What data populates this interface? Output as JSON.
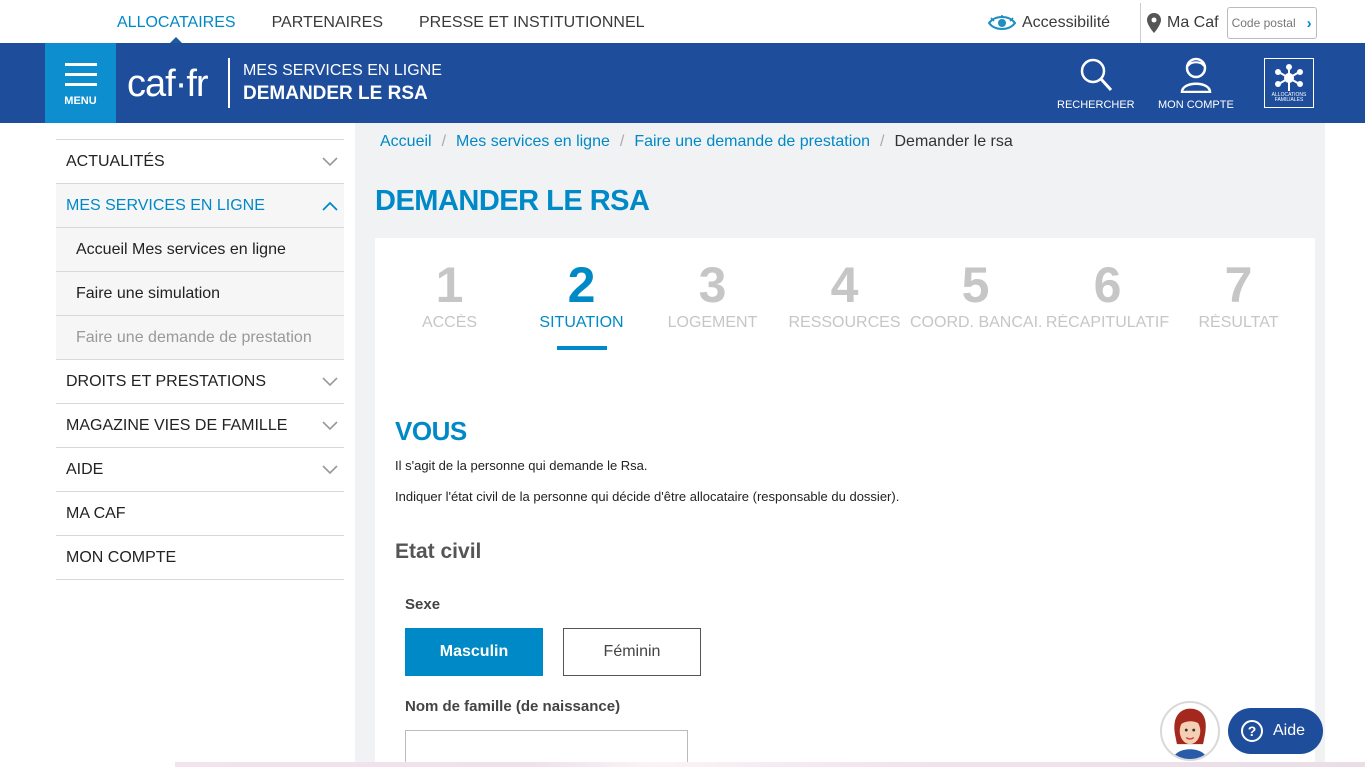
{
  "topbar": {
    "nav": [
      {
        "label": "ALLOCATAIRES",
        "active": true
      },
      {
        "label": "PARTENAIRES",
        "active": false
      },
      {
        "label": "PRESSE ET INSTITUTIONNEL",
        "active": false
      }
    ],
    "accessibility": "Accessibilité",
    "ma_caf": "Ma Caf",
    "postal_placeholder": "Code postal"
  },
  "header": {
    "menu_label": "MENU",
    "logo": "caf·fr",
    "title_line1": "MES SERVICES EN LIGNE",
    "title_line2": "DEMANDER LE RSA",
    "search_label": "RECHERCHER",
    "account_label": "MON COMPTE",
    "brand_small": "ALLOCATIONS FAMILIALES"
  },
  "sidebar": {
    "items": [
      {
        "label": "ACTUALITÉS"
      },
      {
        "label": "MES SERVICES EN LIGNE"
      },
      {
        "label": "Accueil Mes services en ligne"
      },
      {
        "label": "Faire une simulation"
      },
      {
        "label": "Faire une demande de prestation"
      },
      {
        "label": "DROITS ET PRESTATIONS"
      },
      {
        "label": "MAGAZINE VIES DE FAMILLE"
      },
      {
        "label": "AIDE"
      },
      {
        "label": "MA CAF"
      },
      {
        "label": "MON COMPTE"
      }
    ]
  },
  "breadcrumb": {
    "items": [
      "Accueil",
      "Mes services en ligne",
      "Faire une demande de prestation"
    ],
    "current": "Demander le rsa"
  },
  "page_title": "DEMANDER LE RSA",
  "steps": [
    {
      "num": "1",
      "label": "ACCÈS"
    },
    {
      "num": "2",
      "label": "SITUATION"
    },
    {
      "num": "3",
      "label": "LOGEMENT"
    },
    {
      "num": "4",
      "label": "RESSOURCES"
    },
    {
      "num": "5",
      "label": "COORD. BANCAI..."
    },
    {
      "num": "6",
      "label": "RÉCAPITULATIF"
    },
    {
      "num": "7",
      "label": "RÉSULTAT"
    }
  ],
  "form": {
    "section_title": "VOUS",
    "para1": "Il s'agit de la personne qui demande le Rsa.",
    "para2": "Indiquer l'état civil de la personne qui décide d'être allocataire (responsable du dossier).",
    "subheading": "Etat civil",
    "sexe_label": "Sexe",
    "sexe_options": [
      "Masculin",
      "Féminin"
    ],
    "nom_label": "Nom de famille (de naissance)",
    "nom_value": ""
  },
  "help": {
    "label": "Aide"
  },
  "colors": {
    "primary_blue": "#1e4d9b",
    "accent_blue": "#0089c7"
  }
}
